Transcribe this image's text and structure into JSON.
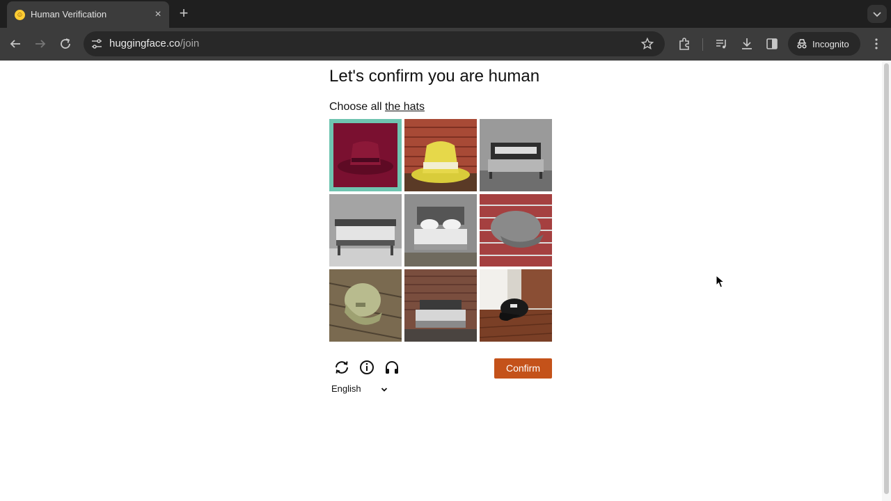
{
  "browser": {
    "tab": {
      "title": "Human Verification",
      "favicon": "hugging-face-emoji",
      "close": "×"
    },
    "new_tab": "+",
    "address": {
      "host": "huggingface.co",
      "path": "/join"
    },
    "incognito_label": "Incognito",
    "icons": [
      "back-icon",
      "forward-icon",
      "reload-icon",
      "site-info-icon",
      "star-icon",
      "extensions-icon",
      "media-icon",
      "download-icon",
      "side-panel-icon",
      "incognito-icon",
      "menu-icon",
      "tab-search-icon"
    ]
  },
  "captcha": {
    "heading": "Let's confirm you are human",
    "prompt_prefix": "Choose all ",
    "prompt_target": "the hats",
    "tiles": [
      {
        "subject": "maroon fedora hat on teal background"
      },
      {
        "subject": "yellow bucket hat"
      },
      {
        "subject": "grey bed"
      },
      {
        "subject": "grey bed"
      },
      {
        "subject": "bed with white pillows"
      },
      {
        "subject": "grey cap on brick wall"
      },
      {
        "subject": "green baseball cap on wood"
      },
      {
        "subject": "bed in brick room"
      },
      {
        "subject": "black cap on wood floor"
      }
    ],
    "controls": [
      "refresh-icon",
      "info-icon",
      "audio-icon"
    ],
    "language": "English",
    "confirm_label": "Confirm",
    "colors": {
      "confirm": "#c4521a"
    }
  }
}
